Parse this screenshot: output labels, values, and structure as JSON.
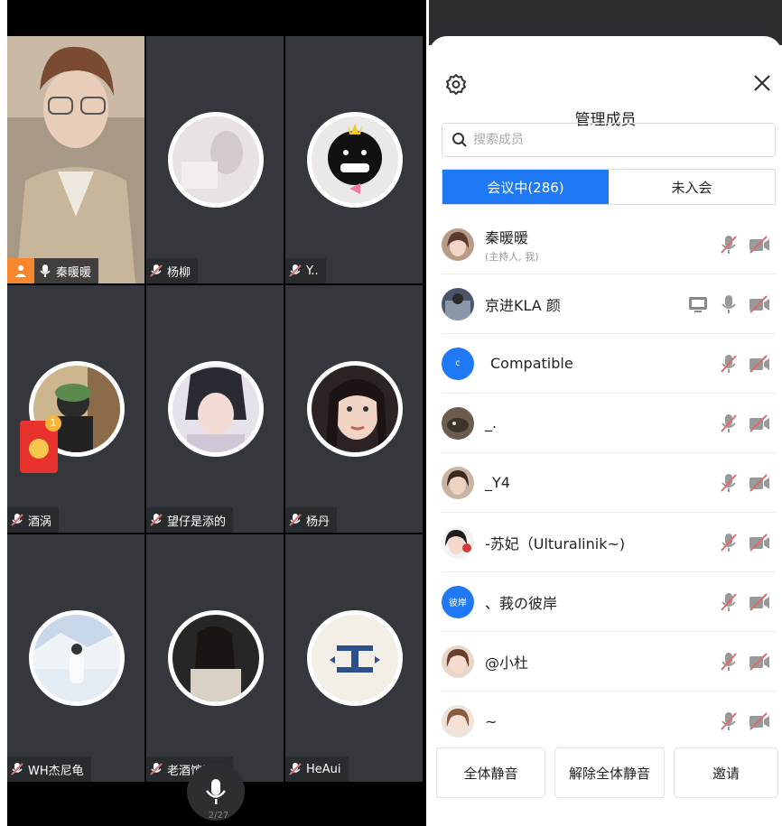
{
  "panel": {
    "title": "管理成员",
    "search_placeholder": "搜索成员",
    "tabs": [
      {
        "label": "会议中(286)",
        "active": true
      },
      {
        "label": "未入会",
        "active": false
      }
    ],
    "members": [
      {
        "name": "秦暖暖",
        "sub": "(主持人, 我)",
        "avatar": "photo",
        "sharing": false
      },
      {
        "name": "京进KLA  颜",
        "sub": "",
        "avatar": "photo",
        "sharing": true
      },
      {
        "name": "Compatible",
        "sub": "",
        "avatar": "letter",
        "avatar_text": "c",
        "avatar_color": "#1f79f4",
        "sharing": false
      },
      {
        "name": "_.",
        "sub": "",
        "avatar": "photo",
        "sharing": false
      },
      {
        "name": "_Y4",
        "sub": "",
        "avatar": "photo",
        "sharing": false
      },
      {
        "name": "-苏妃（Ulturalinik~)",
        "sub": "",
        "avatar": "photo",
        "sharing": false
      },
      {
        "name": "、莪の彼岸",
        "sub": "",
        "avatar": "letter",
        "avatar_text": "彼岸",
        "avatar_color": "#1f79f4",
        "sharing": false
      },
      {
        "name": "@小杜",
        "sub": "",
        "avatar": "photo",
        "sharing": false
      },
      {
        "name": "~",
        "sub": "",
        "avatar": "photo",
        "sharing": false
      }
    ],
    "footer": {
      "mute_all": "全体静音",
      "unmute_all": "解除全体静音",
      "invite": "邀请"
    }
  },
  "grid": {
    "tiles": [
      {
        "name": "秦暖暖",
        "host": true
      },
      {
        "name": "杨柳"
      },
      {
        "name": "Y.."
      },
      {
        "name": "酒涡"
      },
      {
        "name": "望仔是添的"
      },
      {
        "name": "杨丹"
      },
      {
        "name": "WH杰尼龟"
      },
      {
        "name": "老酒馆旧友"
      },
      {
        "name": "HeAui"
      }
    ],
    "mic_count": "2/27",
    "red_packet_badge": "1"
  },
  "colors": {
    "accent": "#1f79f4",
    "tile_bg": "#34373b",
    "muted_red": "#e06a6a",
    "host_orange": "#f7862c"
  }
}
